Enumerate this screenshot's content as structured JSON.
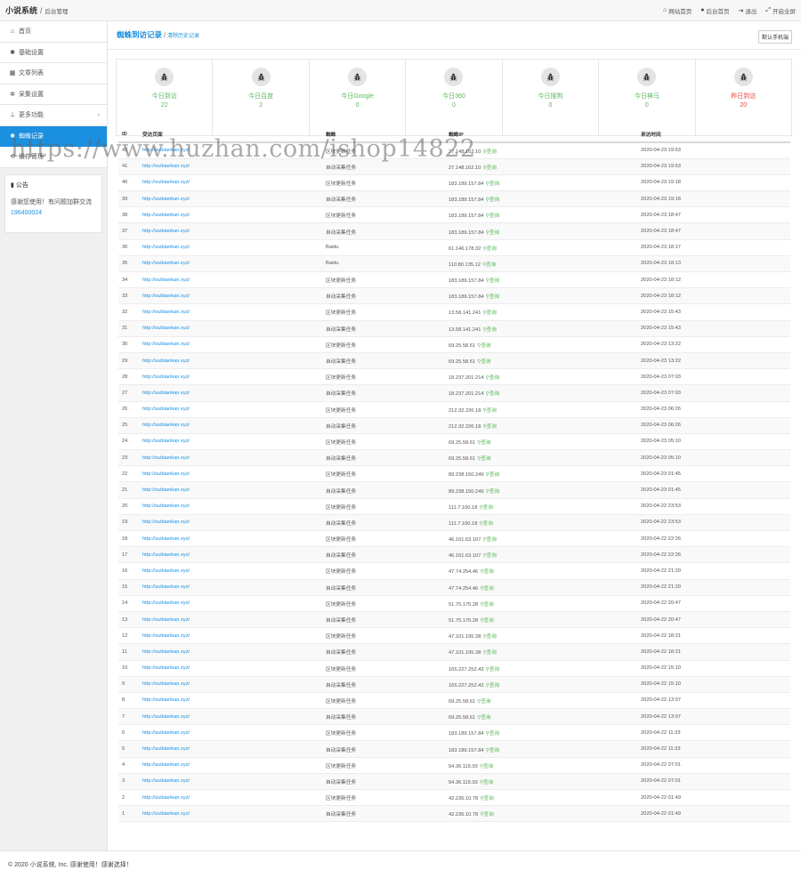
{
  "topbar": {
    "brand": "小说系统",
    "sub": "后台管理",
    "actions": [
      {
        "icon": "home-icon",
        "label": "网站首页"
      },
      {
        "icon": "user-icon",
        "label": "后台首页"
      },
      {
        "icon": "logout-icon",
        "label": "退出"
      },
      {
        "icon": "fullscreen-icon",
        "label": "开启全屏"
      }
    ]
  },
  "sidebar": {
    "items": [
      {
        "icon": "home-icon",
        "label": "首页"
      },
      {
        "icon": "gear-icon",
        "label": "基础设置"
      },
      {
        "icon": "table-icon",
        "label": "文章列表"
      },
      {
        "icon": "cogs-icon",
        "label": "采集设置"
      },
      {
        "icon": "sitemap-icon",
        "label": "更多功能"
      },
      {
        "icon": "bug-icon",
        "label": "蜘蛛记录"
      },
      {
        "icon": "refresh-icon",
        "label": "缓存管理"
      }
    ],
    "notice": {
      "title": "公告",
      "text": "感谢您使用！有问题加群交流",
      "link": "196400024"
    }
  },
  "page": {
    "title": "蜘蛛到访记录",
    "clear_link": "清除历史记录",
    "mobile_button": "默认手机端"
  },
  "stats": [
    {
      "label": "今日到访",
      "value": "22"
    },
    {
      "label": "今日百度",
      "value": "2"
    },
    {
      "label": "今日Google",
      "value": "0"
    },
    {
      "label": "今日360",
      "value": "0"
    },
    {
      "label": "今日搜狗",
      "value": "0"
    },
    {
      "label": "今日神马",
      "value": "0"
    },
    {
      "label": "昨日到访",
      "value": "20"
    }
  ],
  "colors": {
    "accent": "#1b8fe0",
    "green": "#5cb85c",
    "red": "#e0473d"
  },
  "table": {
    "headers": [
      "ID",
      "受访页面",
      "蜘蛛",
      "蜘蛛IP",
      "来访时间"
    ],
    "query_label": "查询",
    "rows": [
      [
        "42",
        "http://suibiankan.xyz/",
        "区块更新任务",
        "27.148.162.10",
        "2020-04-23 19:53"
      ],
      [
        "41",
        "http://suibiankan.xyz/",
        "自动采集任务",
        "27.148.162.10",
        "2020-04-23 19:53"
      ],
      [
        "40",
        "http://suibiankan.xyz/",
        "区块更新任务",
        "183.189.157.84",
        "2020-04-23 19:18"
      ],
      [
        "39",
        "http://suibiankan.xyz/",
        "自动采集任务",
        "183.189.157.84",
        "2020-04-23 19:18"
      ],
      [
        "38",
        "http://suibiankan.xyz/",
        "区块更新任务",
        "183.189.157.84",
        "2020-04-23 18:47"
      ],
      [
        "37",
        "http://suibiankan.xyz/",
        "自动采集任务",
        "183.189.157.84",
        "2020-04-23 18:47"
      ],
      [
        "36",
        "http://suibiankan.xyz/",
        "Baidu",
        "61.146.178.32",
        "2020-04-23 18:17"
      ],
      [
        "35",
        "http://suibiankan.xyz/",
        "Baidu",
        "110.80.135.12",
        "2020-04-23 18:13"
      ],
      [
        "34",
        "http://suibiankan.xyz/",
        "区块更新任务",
        "183.189.157.84",
        "2020-04-23 18:12"
      ],
      [
        "33",
        "http://suibiankan.xyz/",
        "自动采集任务",
        "183.189.157.84",
        "2020-04-23 18:12"
      ],
      [
        "32",
        "http://suibiankan.xyz/",
        "区块更新任务",
        "13.58.141.241",
        "2020-04-23 15:43"
      ],
      [
        "31",
        "http://suibiankan.xyz/",
        "自动采集任务",
        "13.58.141.241",
        "2020-04-23 15:43"
      ],
      [
        "30",
        "http://suibiankan.xyz/",
        "区块更新任务",
        "69.25.58.61",
        "2020-04-23 13:22"
      ],
      [
        "29",
        "http://suibiankan.xyz/",
        "自动采集任务",
        "69.25.58.61",
        "2020-04-23 13:22"
      ],
      [
        "28",
        "http://suibiankan.xyz/",
        "区块更新任务",
        "18.237.201.214",
        "2020-04-23 07:03"
      ],
      [
        "27",
        "http://suibiankan.xyz/",
        "自动采集任务",
        "18.237.201.214",
        "2020-04-23 07:03"
      ],
      [
        "26",
        "http://suibiankan.xyz/",
        "区块更新任务",
        "212.32.226.18",
        "2020-04-23 06:26"
      ],
      [
        "25",
        "http://suibiankan.xyz/",
        "自动采集任务",
        "212.32.226.18",
        "2020-04-23 06:26"
      ],
      [
        "24",
        "http://suibiankan.xyz/",
        "区块更新任务",
        "69.25.58.61",
        "2020-04-23 05:10"
      ],
      [
        "23",
        "http://suibiankan.xyz/",
        "自动采集任务",
        "69.25.58.61",
        "2020-04-23 05:10"
      ],
      [
        "22",
        "http://suibiankan.xyz/",
        "区块更新任务",
        "89.238.150.249",
        "2020-04-23 01:45"
      ],
      [
        "21",
        "http://suibiankan.xyz/",
        "自动采集任务",
        "89.238.150.249",
        "2020-04-23 01:45"
      ],
      [
        "20",
        "http://suibiankan.xyz/",
        "区块更新任务",
        "111.7.100.18",
        "2020-04-22 23:53"
      ],
      [
        "19",
        "http://suibiankan.xyz/",
        "自动采集任务",
        "111.7.100.18",
        "2020-04-22 23:53"
      ],
      [
        "18",
        "http://suibiankan.xyz/",
        "区块更新任务",
        "46.161.63.107",
        "2020-04-22 22:26"
      ],
      [
        "17",
        "http://suibiankan.xyz/",
        "自动采集任务",
        "46.161.63.107",
        "2020-04-22 22:26"
      ],
      [
        "16",
        "http://suibiankan.xyz/",
        "区块更新任务",
        "47.74.254.46",
        "2020-04-22 21:20"
      ],
      [
        "15",
        "http://suibiankan.xyz/",
        "自动采集任务",
        "47.74.254.46",
        "2020-04-22 21:20"
      ],
      [
        "14",
        "http://suibiankan.xyz/",
        "区块更新任务",
        "51.75.175.28",
        "2020-04-22 20:47"
      ],
      [
        "13",
        "http://suibiankan.xyz/",
        "自动采集任务",
        "51.75.175.28",
        "2020-04-22 20:47"
      ],
      [
        "12",
        "http://suibiankan.xyz/",
        "区块更新任务",
        "47.101.195.38",
        "2020-04-22 18:21"
      ],
      [
        "11",
        "http://suibiankan.xyz/",
        "自动采集任务",
        "47.101.195.38",
        "2020-04-22 18:21"
      ],
      [
        "10",
        "http://suibiankan.xyz/",
        "区块更新任务",
        "165.227.252.43",
        "2020-04-22 15:10"
      ],
      [
        "9",
        "http://suibiankan.xyz/",
        "自动采集任务",
        "165.227.252.43",
        "2020-04-22 15:10"
      ],
      [
        "8",
        "http://suibiankan.xyz/",
        "区块更新任务",
        "69.25.58.61",
        "2020-04-22 13:07"
      ],
      [
        "7",
        "http://suibiankan.xyz/",
        "自动采集任务",
        "69.25.58.61",
        "2020-04-22 13:07"
      ],
      [
        "6",
        "http://suibiankan.xyz/",
        "区块更新任务",
        "183.189.157.84",
        "2020-04-22 11:33"
      ],
      [
        "5",
        "http://suibiankan.xyz/",
        "自动采集任务",
        "183.189.157.84",
        "2020-04-22 11:33"
      ],
      [
        "4",
        "http://suibiankan.xyz/",
        "区块更新任务",
        "54.36.115.93",
        "2020-04-22 07:01"
      ],
      [
        "3",
        "http://suibiankan.xyz/",
        "自动采集任务",
        "54.36.115.93",
        "2020-04-22 07:01"
      ],
      [
        "2",
        "http://suibiankan.xyz/",
        "区块更新任务",
        "42.236.10.78",
        "2020-04-22 01:49"
      ],
      [
        "1",
        "http://suibiankan.xyz/",
        "自动采集任务",
        "42.236.10.78",
        "2020-04-22 01:49"
      ]
    ]
  },
  "watermark": "https://www.huzhan.com/ishop14822",
  "footer": "© 2020 小说系统, Inc. 感谢使用！感谢选择！"
}
